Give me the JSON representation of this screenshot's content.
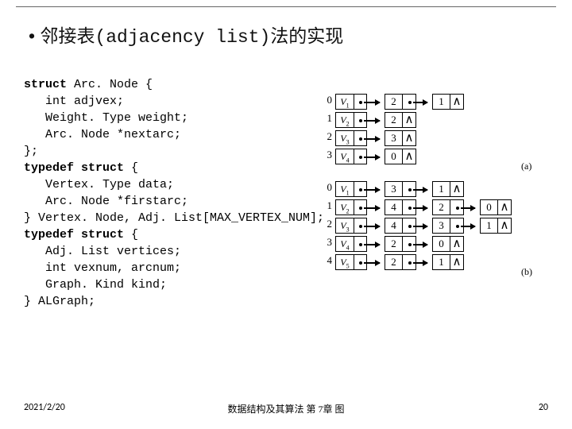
{
  "title": {
    "bullet": "•",
    "zh1": "邻接表",
    "paren": "(adjacency list)",
    "zh2": "法的实现"
  },
  "code": {
    "l1a": "struct",
    "l1b": " Arc. Node {",
    "l2": "   int adjvex;",
    "l3": "   Weight. Type weight;",
    "l4": "   Arc. Node *nextarc;",
    "l5": "};",
    "l6a": "typedef struct",
    "l6b": " {",
    "l7": "   Vertex. Type data;",
    "l8": "   Arc. Node *firstarc;",
    "l9": "} Vertex. Node, Adj. List[MAX_VERTEX_NUM];",
    "l10a": "typedef struct",
    "l10b": " {",
    "l11": "   Adj. List vertices;",
    "l12": "   int vexnum, arcnum;",
    "l13": "   Graph. Kind kind;",
    "l14": "} ALGraph;"
  },
  "chart_data": [
    {
      "type": "table",
      "label": "(a)",
      "vertices": [
        "V1",
        "V2",
        "V3",
        "V4"
      ],
      "adjacency": [
        [
          2,
          1
        ],
        [
          2
        ],
        [
          3
        ],
        [
          0
        ]
      ]
    },
    {
      "type": "table",
      "label": "(b)",
      "vertices": [
        "V1",
        "V2",
        "V3",
        "V4",
        "V5"
      ],
      "adjacency": [
        [
          3,
          1
        ],
        [
          4,
          2,
          0
        ],
        [
          4,
          3,
          1
        ],
        [
          2,
          0
        ],
        [
          2,
          1
        ]
      ]
    }
  ],
  "footer": {
    "date": "2021/2/20",
    "center": "数据结构及其算法 第 7章 图",
    "page": "20"
  }
}
